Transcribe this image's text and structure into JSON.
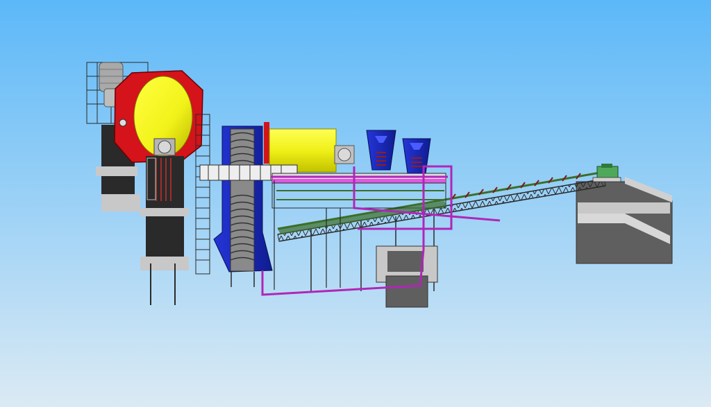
{
  "scene": {
    "subject": "",
    "colors": {
      "sky_top": "#5cb8f8",
      "sky_bottom": "#dbeaf4",
      "concrete": "#5f5f5f",
      "concrete_light": "#c8c8c8",
      "structure_dark": "#2a2a2a",
      "mill_shell": "#f2f21a",
      "mill_head": "#d4131a",
      "classifier": "#1e2fc8",
      "pipe": "#b026b8",
      "conveyor_green": "#3c6e2a",
      "motor_gray": "#a9a9a9",
      "drive_green": "#4fa85a"
    }
  }
}
